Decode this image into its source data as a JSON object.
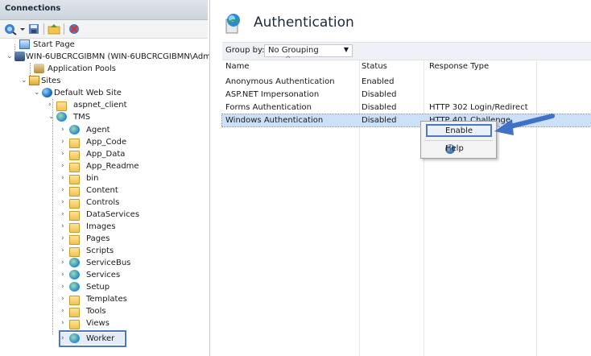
{
  "connections": {
    "title": "Connections",
    "toolbar": [
      {
        "name": "connect-icon"
      },
      {
        "name": "save-icon"
      },
      {
        "name": "up-folder-icon"
      },
      {
        "name": "disconnect-icon"
      }
    ],
    "tree": [
      {
        "label": "Start Page",
        "icon": "start-page-icon"
      },
      {
        "label": "WIN-6UBCRCGIBMN (WIN-6UBCRCGIBMN\\Adm",
        "icon": "server-icon"
      },
      {
        "label": "Application Pools",
        "icon": "app-pools-icon"
      },
      {
        "label": "Sites",
        "icon": "sites-folder-icon"
      },
      {
        "label": "Default Web Site",
        "icon": "globe-icon"
      },
      {
        "label": "aspnet_client",
        "icon": "folder-icon"
      },
      {
        "label": "TMS",
        "icon": "application-icon"
      },
      {
        "label": "Agent",
        "icon": "application-icon"
      },
      {
        "label": "App_Code",
        "icon": "folder-icon"
      },
      {
        "label": "App_Data",
        "icon": "folder-icon"
      },
      {
        "label": "App_Readme",
        "icon": "folder-icon"
      },
      {
        "label": "bin",
        "icon": "folder-icon"
      },
      {
        "label": "Content",
        "icon": "folder-icon"
      },
      {
        "label": "Controls",
        "icon": "folder-icon"
      },
      {
        "label": "DataServices",
        "icon": "folder-icon"
      },
      {
        "label": "Images",
        "icon": "folder-icon"
      },
      {
        "label": "Pages",
        "icon": "folder-icon"
      },
      {
        "label": "Scripts",
        "icon": "folder-icon"
      },
      {
        "label": "ServiceBus",
        "icon": "application-icon"
      },
      {
        "label": "Services",
        "icon": "application-icon"
      },
      {
        "label": "Setup",
        "icon": "application-icon"
      },
      {
        "label": "Templates",
        "icon": "folder-icon"
      },
      {
        "label": "Tools",
        "icon": "folder-icon"
      },
      {
        "label": "Views",
        "icon": "folder-icon"
      },
      {
        "label": "Worker",
        "icon": "application-icon"
      }
    ]
  },
  "feature": {
    "title": "Authentication",
    "icon": "authentication-icon",
    "group_by_label": "Group by:",
    "group_by_value": "No Grouping",
    "columns": [
      "Name",
      "Status",
      "Response Type"
    ],
    "rows": [
      {
        "name": "Anonymous Authentication",
        "status": "Enabled",
        "response": ""
      },
      {
        "name": "ASP.NET Impersonation",
        "status": "Disabled",
        "response": ""
      },
      {
        "name": "Forms Authentication",
        "status": "Disabled",
        "response": "HTTP 302 Login/Redirect"
      },
      {
        "name": "Windows Authentication",
        "status": "Disabled",
        "response": "HTTP 401 Challenge"
      }
    ]
  },
  "context_menu": {
    "items": [
      "Enable",
      "Help"
    ]
  },
  "colors": {
    "selection": "#cce0f7",
    "highlight_border": "#4a78c2",
    "arrow": "#3f72c6"
  }
}
